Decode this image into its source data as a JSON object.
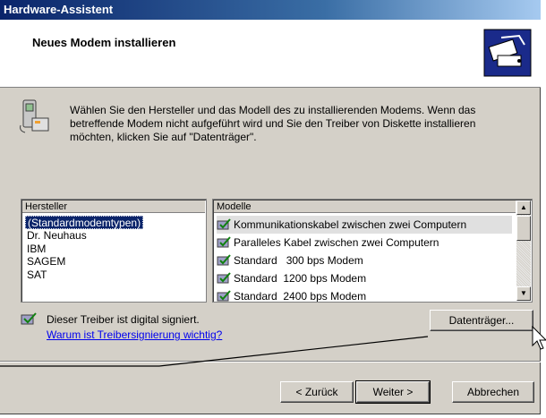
{
  "window": {
    "title": "Hardware-Assistent"
  },
  "header": {
    "title": "Neues Modem installieren",
    "icon": "modem-install-icon"
  },
  "intro": {
    "icon": "modem-phone-icon",
    "text": "Wählen Sie den Hersteller und das Modell des zu installierenden Modems. Wenn das betreffende Modem nicht aufgeführt wird und Sie den Treiber von Diskette installieren möchten, klicken Sie auf \"Datenträger\"."
  },
  "hersteller": {
    "header": "Hersteller",
    "items": [
      "(Standardmodemtypen)",
      "Dr. Neuhaus",
      "IBM",
      "SAGEM",
      "SAT"
    ],
    "selected_index": 0
  },
  "modelle": {
    "header": "Modelle",
    "items": [
      "Kommunikationskabel zwischen zwei Computern",
      "Paralleles Kabel zwischen zwei Computern",
      "Standard   300 bps Modem",
      "Standard  1200 bps Modem",
      "Standard  2400 bps Modem"
    ],
    "selected_index": 0,
    "item_icon": "signed-driver-icon"
  },
  "signature": {
    "text": "Dieser Treiber ist digital signiert.",
    "link": "Warum ist Treibersignierung wichtig?"
  },
  "buttons": {
    "datentraeger": "Datenträger...",
    "back": "< Zurück",
    "next": "Weiter >",
    "cancel": "Abbrechen"
  },
  "colors": {
    "titlebar": "#0a246a",
    "dialog_bg": "#d4d0c8",
    "selection": "#0a246a",
    "link": "#0000ee"
  }
}
